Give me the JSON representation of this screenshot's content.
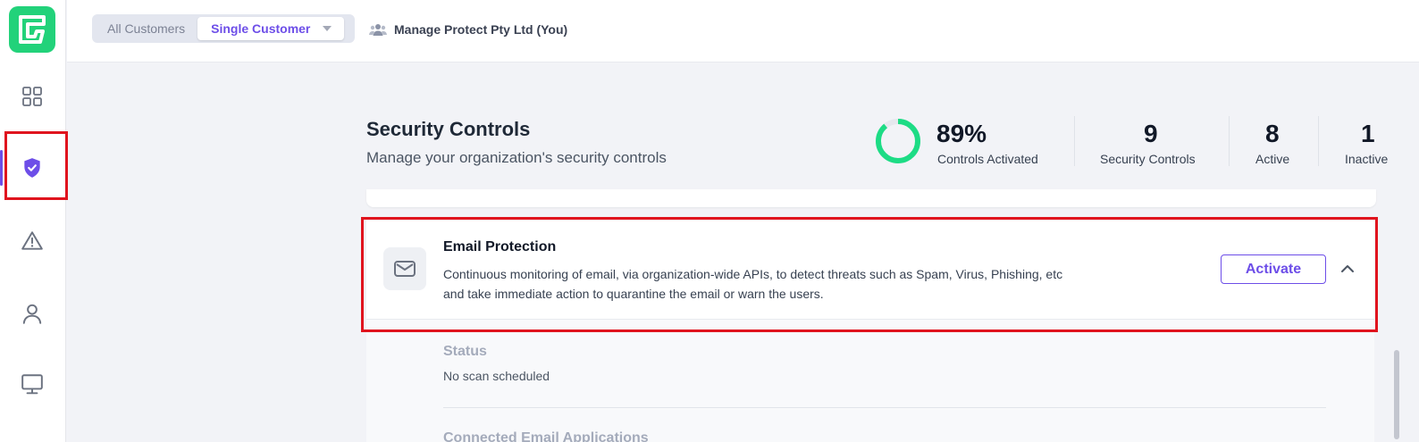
{
  "brand": {
    "accent": "#6d4ee8",
    "logo_color": "#22d27a",
    "highlight": "#e0141e"
  },
  "sidebar": {
    "items": [
      {
        "name": "dashboard",
        "icon": "grid-icon"
      },
      {
        "name": "security-controls",
        "icon": "shield-check-icon",
        "active": true
      },
      {
        "name": "alerts",
        "icon": "warning-icon"
      },
      {
        "name": "users",
        "icon": "user-icon"
      },
      {
        "name": "devices",
        "icon": "monitor-icon"
      }
    ]
  },
  "topbar": {
    "scope_all": "All Customers",
    "scope_single": "Single Customer",
    "customer_name": "Manage Protect Pty Ltd (You)"
  },
  "header": {
    "title": "Security Controls",
    "subtitle": "Manage your organization's security controls"
  },
  "stats": {
    "activated_pct": "89%",
    "activated_fraction": 0.89,
    "activated_label": "Controls Activated",
    "total_value": "9",
    "total_label": "Security Controls",
    "active_value": "8",
    "active_label": "Active",
    "inactive_value": "1",
    "inactive_label": "Inactive"
  },
  "control": {
    "title": "Email Protection",
    "description": "Continuous monitoring of email, via organization-wide APIs, to detect threats such as Spam, Virus, Phishing, etc and take immediate action to quarantine the email or warn the users.",
    "action_label": "Activate",
    "status_label": "Status",
    "status_value": "No scan scheduled",
    "next_section_label": "Connected Email Applications"
  }
}
